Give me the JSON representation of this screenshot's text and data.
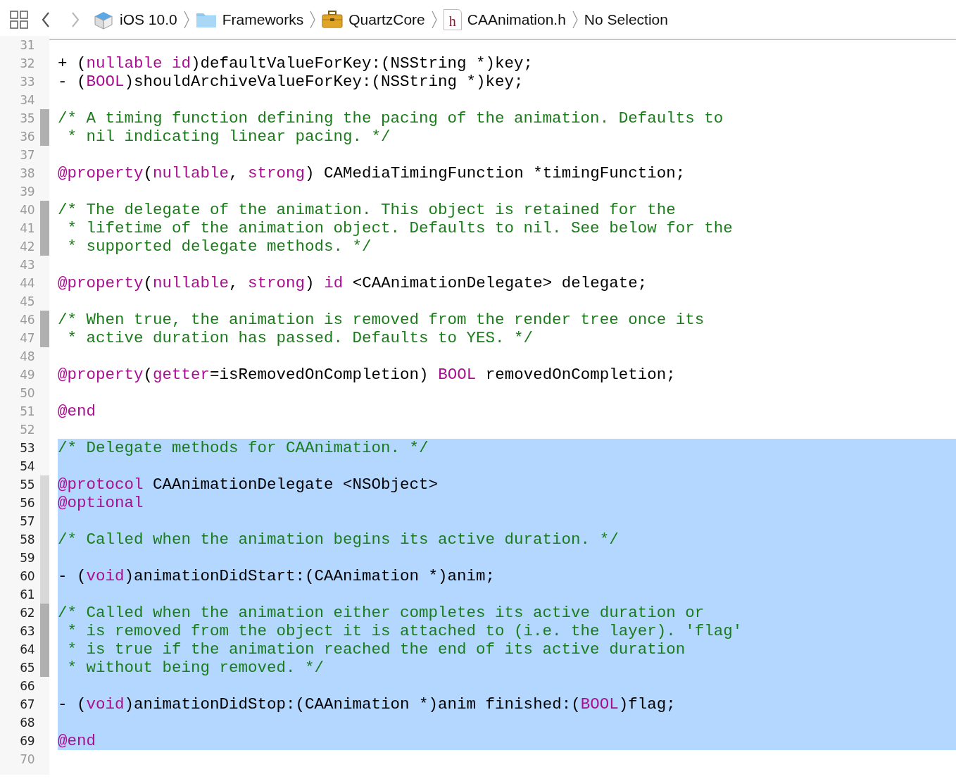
{
  "toolbar": {
    "back_enabled": true,
    "forward_enabled": false
  },
  "breadcrumbs": [
    {
      "kind": "sdk",
      "label": "iOS 10.0"
    },
    {
      "kind": "folder",
      "label": "Frameworks"
    },
    {
      "kind": "toolbox",
      "label": "QuartzCore"
    },
    {
      "kind": "header",
      "icon_glyph": "h",
      "label": "CAAnimation.h"
    },
    {
      "kind": "none",
      "label": "No Selection"
    }
  ],
  "lines": [
    {
      "number": "31",
      "selected": false,
      "comment_ribbon": false,
      "block_ribbon": false
    },
    {
      "number": "32",
      "selected": false,
      "comment_ribbon": false,
      "block_ribbon": false,
      "segments": [
        {
          "kind": "plain",
          "text": "+ ("
        },
        {
          "kind": "keyword",
          "text": "nullable id"
        },
        {
          "kind": "plain",
          "text": ")defaultValueForKey:(NSString *)key;"
        }
      ]
    },
    {
      "number": "33",
      "selected": false,
      "comment_ribbon": false,
      "block_ribbon": false,
      "segments": [
        {
          "kind": "plain",
          "text": "- ("
        },
        {
          "kind": "keyword",
          "text": "BOOL"
        },
        {
          "kind": "plain",
          "text": ")shouldArchiveValueForKey:(NSString *)key;"
        }
      ]
    },
    {
      "number": "34",
      "selected": false,
      "comment_ribbon": false,
      "block_ribbon": false
    },
    {
      "number": "35",
      "selected": false,
      "comment_ribbon": true,
      "block_ribbon": false,
      "segments": [
        {
          "kind": "comment",
          "text": "/* A timing function defining the pacing of the animation. Defaults to"
        }
      ]
    },
    {
      "number": "36",
      "selected": false,
      "comment_ribbon": true,
      "block_ribbon": false,
      "segments": [
        {
          "kind": "comment",
          "text": " * nil indicating linear pacing. */"
        }
      ]
    },
    {
      "number": "37",
      "selected": false,
      "comment_ribbon": false,
      "block_ribbon": false
    },
    {
      "number": "38",
      "selected": false,
      "comment_ribbon": false,
      "block_ribbon": false,
      "segments": [
        {
          "kind": "keyword",
          "text": "@property"
        },
        {
          "kind": "plain",
          "text": "("
        },
        {
          "kind": "keyword",
          "text": "nullable"
        },
        {
          "kind": "plain",
          "text": ", "
        },
        {
          "kind": "keyword",
          "text": "strong"
        },
        {
          "kind": "plain",
          "text": ") CAMediaTimingFunction *timingFunction;"
        }
      ]
    },
    {
      "number": "39",
      "selected": false,
      "comment_ribbon": false,
      "block_ribbon": false
    },
    {
      "number": "40",
      "selected": false,
      "comment_ribbon": true,
      "block_ribbon": false,
      "segments": [
        {
          "kind": "comment",
          "text": "/* The delegate of the animation. This object is retained for the"
        }
      ]
    },
    {
      "number": "41",
      "selected": false,
      "comment_ribbon": true,
      "block_ribbon": false,
      "segments": [
        {
          "kind": "comment",
          "text": " * lifetime of the animation object. Defaults to nil. See below for the"
        }
      ]
    },
    {
      "number": "42",
      "selected": false,
      "comment_ribbon": true,
      "block_ribbon": false,
      "segments": [
        {
          "kind": "comment",
          "text": " * supported delegate methods. */"
        }
      ]
    },
    {
      "number": "43",
      "selected": false,
      "comment_ribbon": false,
      "block_ribbon": false
    },
    {
      "number": "44",
      "selected": false,
      "comment_ribbon": false,
      "block_ribbon": false,
      "segments": [
        {
          "kind": "keyword",
          "text": "@property"
        },
        {
          "kind": "plain",
          "text": "("
        },
        {
          "kind": "keyword",
          "text": "nullable"
        },
        {
          "kind": "plain",
          "text": ", "
        },
        {
          "kind": "keyword",
          "text": "strong"
        },
        {
          "kind": "plain",
          "text": ") "
        },
        {
          "kind": "keyword",
          "text": "id"
        },
        {
          "kind": "plain",
          "text": " <CAAnimationDelegate> delegate;"
        }
      ]
    },
    {
      "number": "45",
      "selected": false,
      "comment_ribbon": false,
      "block_ribbon": false
    },
    {
      "number": "46",
      "selected": false,
      "comment_ribbon": true,
      "block_ribbon": false,
      "segments": [
        {
          "kind": "comment",
          "text": "/* When true, the animation is removed from the render tree once its"
        }
      ]
    },
    {
      "number": "47",
      "selected": false,
      "comment_ribbon": true,
      "block_ribbon": false,
      "segments": [
        {
          "kind": "comment",
          "text": " * active duration has passed. Defaults to YES. */"
        }
      ]
    },
    {
      "number": "48",
      "selected": false,
      "comment_ribbon": false,
      "block_ribbon": false
    },
    {
      "number": "49",
      "selected": false,
      "comment_ribbon": false,
      "block_ribbon": false,
      "segments": [
        {
          "kind": "keyword",
          "text": "@property"
        },
        {
          "kind": "plain",
          "text": "("
        },
        {
          "kind": "keyword",
          "text": "getter"
        },
        {
          "kind": "plain",
          "text": "=isRemovedOnCompletion) "
        },
        {
          "kind": "keyword",
          "text": "BOOL"
        },
        {
          "kind": "plain",
          "text": " removedOnCompletion;"
        }
      ]
    },
    {
      "number": "50",
      "selected": false,
      "comment_ribbon": false,
      "block_ribbon": false
    },
    {
      "number": "51",
      "selected": false,
      "comment_ribbon": false,
      "block_ribbon": false,
      "segments": [
        {
          "kind": "keyword",
          "text": "@end"
        }
      ]
    },
    {
      "number": "52",
      "selected": false,
      "comment_ribbon": false,
      "block_ribbon": false
    },
    {
      "number": "53",
      "selected": true,
      "comment_ribbon": false,
      "block_ribbon": false,
      "segments": [
        {
          "kind": "comment",
          "text": "/* Delegate methods for CAAnimation. */"
        }
      ]
    },
    {
      "number": "54",
      "selected": true,
      "comment_ribbon": false,
      "block_ribbon": false
    },
    {
      "number": "55",
      "selected": true,
      "comment_ribbon": false,
      "block_ribbon": true,
      "segments": [
        {
          "kind": "keyword",
          "text": "@protocol"
        },
        {
          "kind": "plain",
          "text": " CAAnimationDelegate <NSObject>"
        }
      ]
    },
    {
      "number": "56",
      "selected": true,
      "comment_ribbon": false,
      "block_ribbon": true,
      "segments": [
        {
          "kind": "keyword",
          "text": "@optional"
        }
      ]
    },
    {
      "number": "57",
      "selected": true,
      "comment_ribbon": false,
      "block_ribbon": true
    },
    {
      "number": "58",
      "selected": true,
      "comment_ribbon": false,
      "block_ribbon": true,
      "segments": [
        {
          "kind": "comment",
          "text": "/* Called when the animation begins its active duration. */"
        }
      ]
    },
    {
      "number": "59",
      "selected": true,
      "comment_ribbon": false,
      "block_ribbon": true
    },
    {
      "number": "60",
      "selected": true,
      "comment_ribbon": false,
      "block_ribbon": true,
      "segments": [
        {
          "kind": "plain",
          "text": "- ("
        },
        {
          "kind": "keyword",
          "text": "void"
        },
        {
          "kind": "plain",
          "text": ")animationDidStart:(CAAnimation *)anim;"
        }
      ]
    },
    {
      "number": "61",
      "selected": true,
      "comment_ribbon": false,
      "block_ribbon": true
    },
    {
      "number": "62",
      "selected": true,
      "comment_ribbon": true,
      "block_ribbon": false,
      "segments": [
        {
          "kind": "comment",
          "text": "/* Called when the animation either completes its active duration or"
        }
      ]
    },
    {
      "number": "63",
      "selected": true,
      "comment_ribbon": true,
      "block_ribbon": false,
      "segments": [
        {
          "kind": "comment",
          "text": " * is removed from the object it is attached to (i.e. the layer). 'flag'"
        }
      ]
    },
    {
      "number": "64",
      "selected": true,
      "comment_ribbon": true,
      "block_ribbon": false,
      "segments": [
        {
          "kind": "comment",
          "text": " * is true if the animation reached the end of its active duration"
        }
      ]
    },
    {
      "number": "65",
      "selected": true,
      "comment_ribbon": true,
      "block_ribbon": false,
      "segments": [
        {
          "kind": "comment",
          "text": " * without being removed. */"
        }
      ]
    },
    {
      "number": "66",
      "selected": true,
      "comment_ribbon": false,
      "block_ribbon": false
    },
    {
      "number": "67",
      "selected": true,
      "comment_ribbon": false,
      "block_ribbon": false,
      "segments": [
        {
          "kind": "plain",
          "text": "- ("
        },
        {
          "kind": "keyword",
          "text": "void"
        },
        {
          "kind": "plain",
          "text": ")animationDidStop:(CAAnimation *)anim finished:("
        },
        {
          "kind": "keyword",
          "text": "BOOL"
        },
        {
          "kind": "plain",
          "text": ")flag;"
        }
      ]
    },
    {
      "number": "68",
      "selected": true,
      "comment_ribbon": false,
      "block_ribbon": false
    },
    {
      "number": "69",
      "selected": true,
      "comment_ribbon": false,
      "block_ribbon": false,
      "segments": [
        {
          "kind": "keyword",
          "text": "@end"
        }
      ]
    },
    {
      "number": "70",
      "selected": false,
      "comment_ribbon": false,
      "block_ribbon": false
    }
  ]
}
